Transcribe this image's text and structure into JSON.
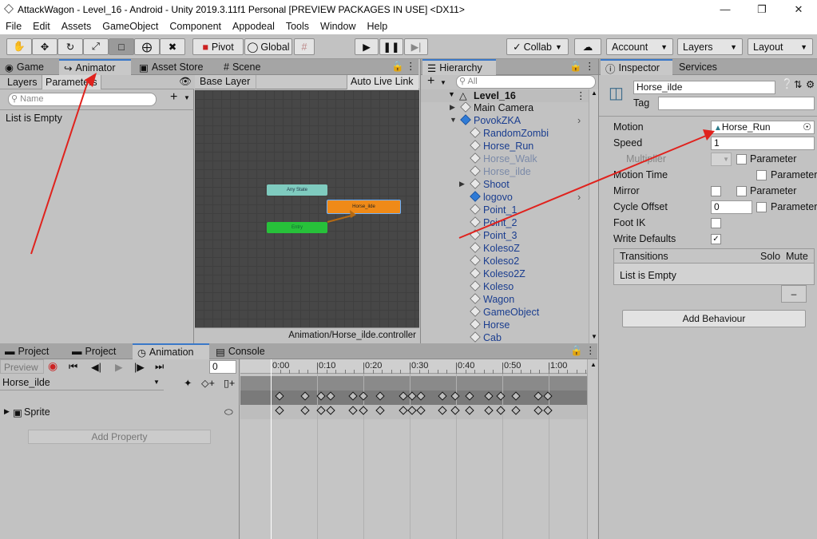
{
  "window": {
    "title": "AttackWagon - Level_16 - Android - Unity 2019.3.11f1 Personal [PREVIEW PACKAGES IN USE] <DX11>"
  },
  "menu": [
    "File",
    "Edit",
    "Assets",
    "GameObject",
    "Component",
    "Appodeal",
    "Tools",
    "Window",
    "Help"
  ],
  "toolbar": {
    "pivot": "Pivot",
    "global": "Global",
    "collab": "Collab",
    "account": "Account",
    "layers": "Layers",
    "layout": "Layout"
  },
  "tabs_top_left": [
    "Game",
    "Animator",
    "Asset Store",
    "Scene"
  ],
  "animator": {
    "sub_tabs": [
      "Layers",
      "Parameters"
    ],
    "search_placeholder": "Name",
    "list_empty": "List is Empty",
    "base_layer": "Base Layer",
    "auto_live_link": "Auto Live Link",
    "nodes": {
      "any_state": "Any State",
      "horse_ilde": "Horse_ilde",
      "entry": "Entry"
    },
    "footer_path": "Animation/Horse_ilde.controller"
  },
  "hierarchy": {
    "tab": "Hierarchy",
    "search_placeholder": "All",
    "scene": "Level_16",
    "items": [
      {
        "label": "Main Camera",
        "indent": 1,
        "blue": false,
        "arrow": true,
        "dim": false,
        "black": true
      },
      {
        "label": "PovokZKA",
        "indent": 1,
        "blue": true,
        "arrow": true,
        "dim": false,
        "black": false
      },
      {
        "label": "RandomZombi",
        "indent": 2,
        "blue": false,
        "arrow": false,
        "dim": false,
        "black": false
      },
      {
        "label": "Horse_Run",
        "indent": 2,
        "blue": false,
        "arrow": false,
        "dim": false,
        "black": false
      },
      {
        "label": "Horse_Walk",
        "indent": 2,
        "blue": false,
        "arrow": false,
        "dim": true,
        "black": false
      },
      {
        "label": "Horse_ilde",
        "indent": 2,
        "blue": false,
        "arrow": false,
        "dim": true,
        "black": false
      },
      {
        "label": "Shoot",
        "indent": 2,
        "blue": false,
        "arrow": true,
        "dim": false,
        "black": false
      },
      {
        "label": "logovo",
        "indent": 2,
        "blue": true,
        "arrow": false,
        "dim": false,
        "black": false
      },
      {
        "label": "Point_1",
        "indent": 2,
        "blue": false,
        "arrow": false,
        "dim": false,
        "black": false
      },
      {
        "label": "Point_2",
        "indent": 2,
        "blue": false,
        "arrow": false,
        "dim": false,
        "black": false
      },
      {
        "label": "Point_3",
        "indent": 2,
        "blue": false,
        "arrow": false,
        "dim": false,
        "black": false
      },
      {
        "label": "KolesoZ",
        "indent": 2,
        "blue": false,
        "arrow": false,
        "dim": false,
        "black": false
      },
      {
        "label": "Koleso2",
        "indent": 2,
        "blue": false,
        "arrow": false,
        "dim": false,
        "black": false
      },
      {
        "label": "Koleso2Z",
        "indent": 2,
        "blue": false,
        "arrow": false,
        "dim": false,
        "black": false
      },
      {
        "label": "Koleso",
        "indent": 2,
        "blue": false,
        "arrow": false,
        "dim": false,
        "black": false
      },
      {
        "label": "Wagon",
        "indent": 2,
        "blue": false,
        "arrow": false,
        "dim": false,
        "black": false
      },
      {
        "label": "GameObject",
        "indent": 2,
        "blue": false,
        "arrow": false,
        "dim": false,
        "black": false
      },
      {
        "label": "Horse",
        "indent": 2,
        "blue": false,
        "arrow": false,
        "dim": false,
        "black": false
      },
      {
        "label": "Cab",
        "indent": 2,
        "blue": false,
        "arrow": false,
        "dim": false,
        "black": false
      }
    ]
  },
  "inspector": {
    "tabs": [
      "Inspector",
      "Services"
    ],
    "name": "Horse_ilde",
    "tag_label": "Tag",
    "motion_label": "Motion",
    "motion_value": "Horse_Run",
    "speed_label": "Speed",
    "speed_value": "1",
    "multiplier_label": "Multiplier",
    "parameter": "Parameter",
    "motion_time_label": "Motion Time",
    "mirror_label": "Mirror",
    "cycle_offset_label": "Cycle Offset",
    "cycle_offset_value": "0",
    "foot_ik_label": "Foot IK",
    "write_defaults_label": "Write Defaults",
    "transitions_label": "Transitions",
    "solo": "Solo",
    "mute": "Mute",
    "transitions_empty": "List is Empty",
    "add_behaviour": "Add Behaviour"
  },
  "bottom_tabs": [
    "Project",
    "Project",
    "Animation",
    "Console"
  ],
  "animation": {
    "preview": "Preview",
    "frame": "0",
    "clip": "Horse_ilde",
    "property": "Sprite",
    "add_property": "Add Property",
    "time_labels": [
      "0:00",
      "0:10",
      "0:20",
      "0:30",
      "0:40",
      "0:50",
      "1:00"
    ]
  },
  "colors": {
    "accent": "#3a78c8",
    "any_state": "#7fcbbf",
    "state_orange": "#ef8a18",
    "entry": "#27c13a",
    "arrow_red": "#e0221d"
  }
}
